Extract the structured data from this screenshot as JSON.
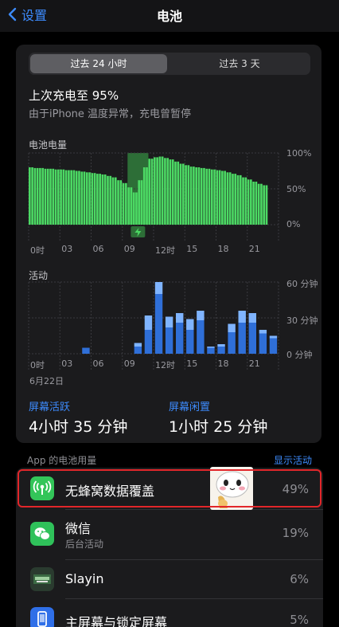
{
  "nav": {
    "back_label": "设置",
    "title": "电池"
  },
  "segments": {
    "tab_24h": "过去 24 小时",
    "tab_3d": "过去 3 天"
  },
  "charge": {
    "title": "上次充电至 95%",
    "subtitle": "由于iPhone 温度异常，充电曾暂停"
  },
  "battery_chart": {
    "label": "电池电量",
    "y_ticks": [
      "100%",
      "50%",
      "0%"
    ],
    "x_ticks": [
      "0时",
      "03",
      "06",
      "09",
      "12时",
      "15",
      "18",
      "21"
    ]
  },
  "activity_chart": {
    "label": "活动",
    "y_ticks": [
      "60 分钟",
      "30 分钟",
      "0 分钟"
    ],
    "x_ticks": [
      "0时",
      "03",
      "06",
      "09",
      "12时",
      "15",
      "18",
      "21"
    ],
    "date_label": "6月22日"
  },
  "stats": {
    "screen_on_label": "屏幕活跃",
    "screen_on_value": "4小时 35 分钟",
    "screen_off_label": "屏幕闲置",
    "screen_off_value": "1小时 25 分钟"
  },
  "usage": {
    "header": "App 的电池用量",
    "show_activity": "显示活动",
    "apps": [
      {
        "name": "无蜂窝数据覆盖",
        "sub": "",
        "percent": "49%",
        "icon": "cellular-icon",
        "color": "#33c559"
      },
      {
        "name": "微信",
        "sub": "后台活动",
        "percent": "19%",
        "icon": "wechat-icon",
        "color": "#2fc15a"
      },
      {
        "name": "Slayin",
        "sub": "",
        "percent": "6%",
        "icon": "slayin-icon",
        "color": "#2a3b2f"
      },
      {
        "name": "主屏幕与锁定屏幕",
        "sub": "",
        "percent": "5%",
        "icon": "home-screen-icon",
        "color": "#2f6fe8"
      }
    ]
  },
  "colors": {
    "accent": "#3d8bfd",
    "battery_green": "#4cd964",
    "activity_dark": "#2f6fd8",
    "activity_light": "#7fb4ff",
    "highlight": "#e2262a"
  },
  "chart_data": [
    {
      "type": "area",
      "title": "电池电量",
      "x_unit": "hour",
      "ylim": [
        0,
        100
      ],
      "ylabel_ticks": [
        "0%",
        "50%",
        "100%"
      ],
      "x": [
        0,
        0.5,
        1,
        1.5,
        2,
        2.5,
        3,
        3.5,
        4,
        4.5,
        5,
        5.5,
        6,
        6.5,
        7,
        7.5,
        8,
        8.5,
        9,
        9.5,
        10,
        10.5,
        11,
        11.5,
        12,
        12.5,
        13,
        13.5,
        14,
        14.5,
        15,
        15.5,
        16,
        16.5,
        17,
        17.5,
        18,
        18.5,
        19,
        19.5,
        20,
        20.5,
        21,
        21.5,
        22,
        22.5
      ],
      "values": [
        80,
        79,
        79,
        78,
        78,
        77,
        77,
        76,
        76,
        75,
        74,
        73,
        72,
        71,
        70,
        68,
        66,
        62,
        58,
        52,
        45,
        62,
        80,
        92,
        94,
        95,
        93,
        91,
        88,
        85,
        83,
        81,
        80,
        79,
        78,
        77,
        76,
        75,
        73,
        71,
        69,
        66,
        63,
        60,
        57,
        55
      ],
      "charging_window": [
        9.5,
        11.5
      ]
    },
    {
      "type": "bar",
      "title": "活动",
      "x_unit": "hour",
      "ylim": [
        0,
        60
      ],
      "ylabel_ticks": [
        "0 分钟",
        "30 分钟",
        "60 分钟"
      ],
      "series": [
        {
          "name": "屏幕活跃",
          "values": [
            0,
            0,
            0,
            0,
            0,
            5,
            0,
            0,
            0,
            0,
            6,
            20,
            50,
            22,
            26,
            20,
            28,
            5,
            6,
            18,
            26,
            26,
            17,
            13
          ]
        },
        {
          "name": "屏幕闲置",
          "values": [
            0,
            0,
            0,
            0,
            0,
            0,
            0,
            0,
            0,
            0,
            3,
            12,
            10,
            9,
            8,
            9,
            8,
            1,
            2,
            7,
            10,
            8,
            3,
            2
          ]
        }
      ],
      "categories": [
        "0",
        "1",
        "2",
        "3",
        "4",
        "5",
        "6",
        "7",
        "8",
        "9",
        "10",
        "11",
        "12",
        "13",
        "14",
        "15",
        "16",
        "17",
        "18",
        "19",
        "20",
        "21",
        "22",
        "23"
      ]
    }
  ]
}
